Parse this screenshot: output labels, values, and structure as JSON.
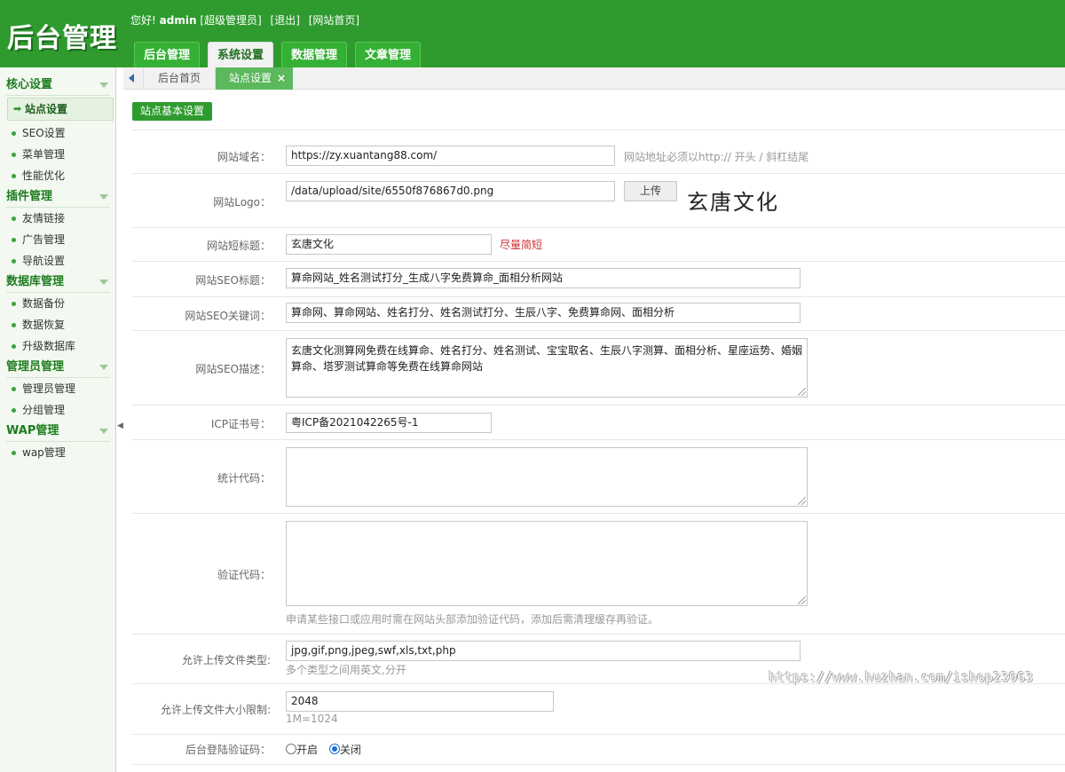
{
  "header": {
    "logo": "后台管理",
    "greeting": "您好!",
    "username": "admin",
    "role": "[超级管理员]",
    "logout": "[退出]",
    "home_link": "[网站首页]",
    "nav": [
      {
        "label": "后台管理"
      },
      {
        "label": "系统设置"
      },
      {
        "label": "数据管理"
      },
      {
        "label": "文章管理"
      }
    ]
  },
  "sidebar": {
    "groups": [
      {
        "title": "核心设置",
        "items": [
          "站点设置",
          "SEO设置",
          "菜单管理",
          "性能优化"
        ]
      },
      {
        "title": "插件管理",
        "items": [
          "友情链接",
          "广告管理",
          "导航设置"
        ]
      },
      {
        "title": "数据库管理",
        "items": [
          "数据备份",
          "数据恢复",
          "升级数据库"
        ]
      },
      {
        "title": "管理员管理",
        "items": [
          "管理员管理",
          "分组管理"
        ]
      },
      {
        "title": "WAP管理",
        "items": [
          "wap管理"
        ]
      }
    ]
  },
  "tabs": {
    "home": "后台首页",
    "current": "站点设置",
    "close": "×"
  },
  "section_button": "站点基本设置",
  "form": {
    "domain": {
      "label": "网站域名：",
      "value": "https://zy.xuantang88.com/",
      "hint": "网站地址必须以http:// 开头 / 斜杠结尾"
    },
    "logo": {
      "label": "网站Logo：",
      "value": "/data/upload/site/6550f876867d0.png",
      "upload": "上传",
      "preview": "玄唐文化"
    },
    "short_title": {
      "label": "网站短标题：",
      "value": "玄唐文化",
      "hint": "尽量简短"
    },
    "seo_title": {
      "label": "网站SEO标题：",
      "value": "算命网站_姓名测试打分_生成八字免费算命_面相分析网站"
    },
    "seo_keywords": {
      "label": "网站SEO关键词：",
      "value": "算命网、算命网站、姓名打分、姓名测试打分、生辰八字、免费算命网、面相分析"
    },
    "seo_desc": {
      "label": "网站SEO描述：",
      "value": "玄唐文化测算网免费在线算命、姓名打分、姓名测试、宝宝取名、生辰八字测算、面相分析、星座运势、婚姻算命、塔罗测试算命等免费在线算命网站"
    },
    "icp": {
      "label": "ICP证书号：",
      "value": "粤ICP备2021042265号-1"
    },
    "stats_code": {
      "label": "统计代码：",
      "value": ""
    },
    "verify_code": {
      "label": "验证代码：",
      "value": "",
      "hint": "申请某些接口或应用时需在网站头部添加验证代码，添加后需清理缓存再验证。"
    },
    "upload_types": {
      "label": "允许上传文件类型:",
      "value": "jpg,gif,png,jpeg,swf,xls,txt,php",
      "hint": "多个类型之间用英文,分开"
    },
    "upload_size": {
      "label": "允许上传文件大小限制:",
      "value": "2048",
      "hint": "1M=1024"
    },
    "login_captcha": {
      "label": "后台登陆验证码：",
      "options": [
        "开启",
        "关闭"
      ],
      "selected": "关闭"
    }
  },
  "watermark": "https://www.huzhan.com/ishop23063"
}
